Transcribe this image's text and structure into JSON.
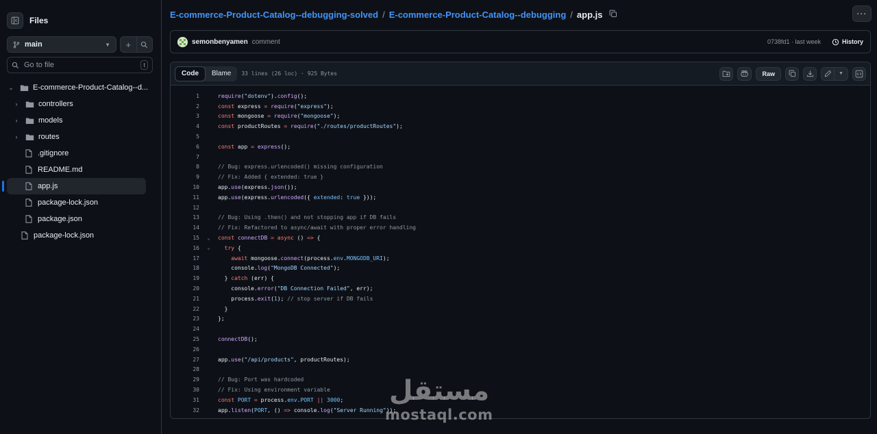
{
  "sidebar": {
    "title": "Files",
    "branch": "main",
    "goto_placeholder": "Go to file",
    "goto_shortcut": "t",
    "tree": [
      {
        "label": "E-commerce-Product-Catalog--d...",
        "type": "folder",
        "expanded": true,
        "depth": 0
      },
      {
        "label": "controllers",
        "type": "folder",
        "expanded": false,
        "depth": 1
      },
      {
        "label": "models",
        "type": "folder",
        "expanded": false,
        "depth": 1
      },
      {
        "label": "routes",
        "type": "folder",
        "expanded": false,
        "depth": 1
      },
      {
        "label": ".gitignore",
        "type": "file",
        "depth": 1
      },
      {
        "label": "README.md",
        "type": "file",
        "depth": 1
      },
      {
        "label": "app.js",
        "type": "file",
        "depth": 1,
        "selected": true
      },
      {
        "label": "package-lock.json",
        "type": "file",
        "depth": 1
      },
      {
        "label": "package.json",
        "type": "file",
        "depth": 1
      },
      {
        "label": "package-lock.json",
        "type": "file",
        "depth": 0
      }
    ]
  },
  "breadcrumb": {
    "repo": "E-commerce-Product-Catalog--debugging-solved",
    "folder": "E-commerce-Product-Catalog--debugging",
    "file": "app.js",
    "separator": "/"
  },
  "commit": {
    "user": "semonbenyamen",
    "message": "comment",
    "meta": "0738fd1 · last week",
    "history_label": "History"
  },
  "file_view": {
    "tab_code": "Code",
    "tab_blame": "Blame",
    "info": "33 lines (26 loc) · 925 Bytes",
    "raw_label": "Raw"
  },
  "code_lines": [
    [
      [
        "f",
        "require"
      ],
      [
        "",
        "("
      ],
      [
        "s",
        "\"dotenv\""
      ],
      [
        "",
        ")."
      ],
      [
        "f",
        "config"
      ],
      [
        "",
        "();"
      ]
    ],
    [
      [
        "k",
        "const"
      ],
      [
        "",
        " express "
      ],
      [
        "k",
        "="
      ],
      [
        "",
        " "
      ],
      [
        "f",
        "require"
      ],
      [
        "",
        "("
      ],
      [
        "s",
        "\"express\""
      ],
      [
        "",
        ");"
      ]
    ],
    [
      [
        "k",
        "const"
      ],
      [
        "",
        " mongoose "
      ],
      [
        "k",
        "="
      ],
      [
        "",
        " "
      ],
      [
        "f",
        "require"
      ],
      [
        "",
        "("
      ],
      [
        "s",
        "\"mongoose\""
      ],
      [
        "",
        ");"
      ]
    ],
    [
      [
        "k",
        "const"
      ],
      [
        "",
        " productRoutes "
      ],
      [
        "k",
        "="
      ],
      [
        "",
        " "
      ],
      [
        "f",
        "require"
      ],
      [
        "",
        "("
      ],
      [
        "s",
        "\"./routes/productRoutes\""
      ],
      [
        "",
        ");"
      ]
    ],
    [],
    [
      [
        "k",
        "const"
      ],
      [
        "",
        " app "
      ],
      [
        "k",
        "="
      ],
      [
        "",
        " "
      ],
      [
        "f",
        "express"
      ],
      [
        "",
        "();"
      ]
    ],
    [],
    [
      [
        "c",
        "// Bug: express.urlencoded() missing configuration"
      ]
    ],
    [
      [
        "c",
        "// Fix: Added { extended: true }"
      ]
    ],
    [
      [
        "",
        "app."
      ],
      [
        "f",
        "use"
      ],
      [
        "",
        "(express."
      ],
      [
        "f",
        "json"
      ],
      [
        "",
        "());"
      ]
    ],
    [
      [
        "",
        "app."
      ],
      [
        "f",
        "use"
      ],
      [
        "",
        "(express."
      ],
      [
        "f",
        "urlencoded"
      ],
      [
        "",
        "({ "
      ],
      [
        "n",
        "extended"
      ],
      [
        "",
        ": "
      ],
      [
        "n",
        "true"
      ],
      [
        "",
        " }));"
      ]
    ],
    [],
    [
      [
        "c",
        "// Bug: Using .then() and not stopping app if DB fails"
      ]
    ],
    [
      [
        "c",
        "// Fix: Refactored to async/await with proper error handling"
      ]
    ],
    [
      [
        "k",
        "const"
      ],
      [
        "",
        " "
      ],
      [
        "f",
        "connectDB"
      ],
      [
        "",
        " "
      ],
      [
        "k",
        "="
      ],
      [
        "",
        " "
      ],
      [
        "k",
        "async"
      ],
      [
        "",
        " () "
      ],
      [
        "k",
        "=>"
      ],
      [
        "",
        " {"
      ]
    ],
    [
      [
        "",
        "  "
      ],
      [
        "k",
        "try"
      ],
      [
        "",
        " {"
      ]
    ],
    [
      [
        "",
        "    "
      ],
      [
        "k",
        "await"
      ],
      [
        "",
        " mongoose."
      ],
      [
        "f",
        "connect"
      ],
      [
        "",
        "(process."
      ],
      [
        "n",
        "env"
      ],
      [
        "",
        "."
      ],
      [
        "n",
        "MONGODB_URI"
      ],
      [
        "",
        ");"
      ]
    ],
    [
      [
        "",
        "    console."
      ],
      [
        "f",
        "log"
      ],
      [
        "",
        "("
      ],
      [
        "s",
        "\"MongoDB Connected\""
      ],
      [
        "",
        ");"
      ]
    ],
    [
      [
        "",
        "  } "
      ],
      [
        "k",
        "catch"
      ],
      [
        "",
        " (err) {"
      ]
    ],
    [
      [
        "",
        "    console."
      ],
      [
        "f",
        "error"
      ],
      [
        "",
        "("
      ],
      [
        "s",
        "\"DB Connection Failed\""
      ],
      [
        "",
        ", err);"
      ]
    ],
    [
      [
        "",
        "    process."
      ],
      [
        "f",
        "exit"
      ],
      [
        "",
        "("
      ],
      [
        "n",
        "1"
      ],
      [
        "",
        "); "
      ],
      [
        "c",
        "// stop server if DB fails"
      ]
    ],
    [
      [
        "",
        "  }"
      ]
    ],
    [
      [
        "",
        "};"
      ]
    ],
    [],
    [
      [
        "f",
        "connectDB"
      ],
      [
        "",
        "();"
      ]
    ],
    [],
    [
      [
        "",
        "app."
      ],
      [
        "f",
        "use"
      ],
      [
        "",
        "("
      ],
      [
        "s",
        "\"/api/products\""
      ],
      [
        "",
        ", productRoutes);"
      ]
    ],
    [],
    [
      [
        "c",
        "// Bug: Port was hardcoded"
      ]
    ],
    [
      [
        "c",
        "// Fix: Using environment variable"
      ]
    ],
    [
      [
        "k",
        "const"
      ],
      [
        "",
        " "
      ],
      [
        "n",
        "PORT"
      ],
      [
        "",
        " "
      ],
      [
        "k",
        "="
      ],
      [
        "",
        " process."
      ],
      [
        "n",
        "env"
      ],
      [
        "",
        "."
      ],
      [
        "n",
        "PORT"
      ],
      [
        "",
        " "
      ],
      [
        "k",
        "||"
      ],
      [
        "",
        " "
      ],
      [
        "n",
        "3000"
      ],
      [
        "",
        ";"
      ]
    ],
    [
      [
        "",
        "app."
      ],
      [
        "f",
        "listen"
      ],
      [
        "",
        "("
      ],
      [
        "n",
        "PORT"
      ],
      [
        "",
        ", () "
      ],
      [
        "k",
        "=>"
      ],
      [
        "",
        " console."
      ],
      [
        "f",
        "log"
      ],
      [
        "",
        "("
      ],
      [
        "s",
        "\"Server Running\""
      ],
      [
        "",
        "));"
      ]
    ]
  ],
  "fold_lines": [
    15,
    16
  ],
  "watermark": {
    "arabic": "مستقل",
    "latin": "mostaql.com"
  }
}
